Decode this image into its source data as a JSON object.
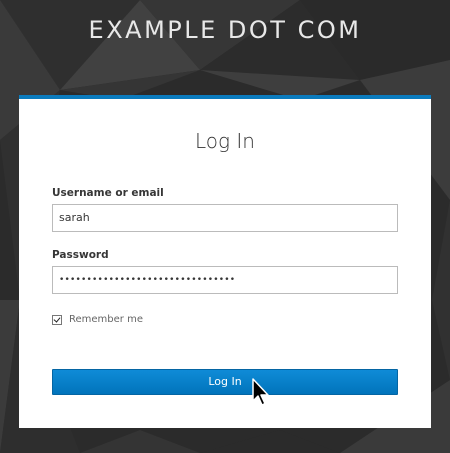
{
  "header": {
    "site_title": "EXAMPLE DOT COM"
  },
  "login_card": {
    "title": "Log In",
    "username_label": "Username or email",
    "username_value": "sarah",
    "password_label": "Password",
    "password_value": "••••••••••••••••••••••••••••••••",
    "remember_label": "Remember me",
    "remember_checked": true,
    "login_button_label": "Log In"
  },
  "colors": {
    "accent": "#0b7bbd",
    "button": "#0a7fc6",
    "background": "#2b2b2b"
  },
  "icons": {
    "cursor": "mouse-pointer-icon",
    "checkbox": "checkmark-icon"
  }
}
